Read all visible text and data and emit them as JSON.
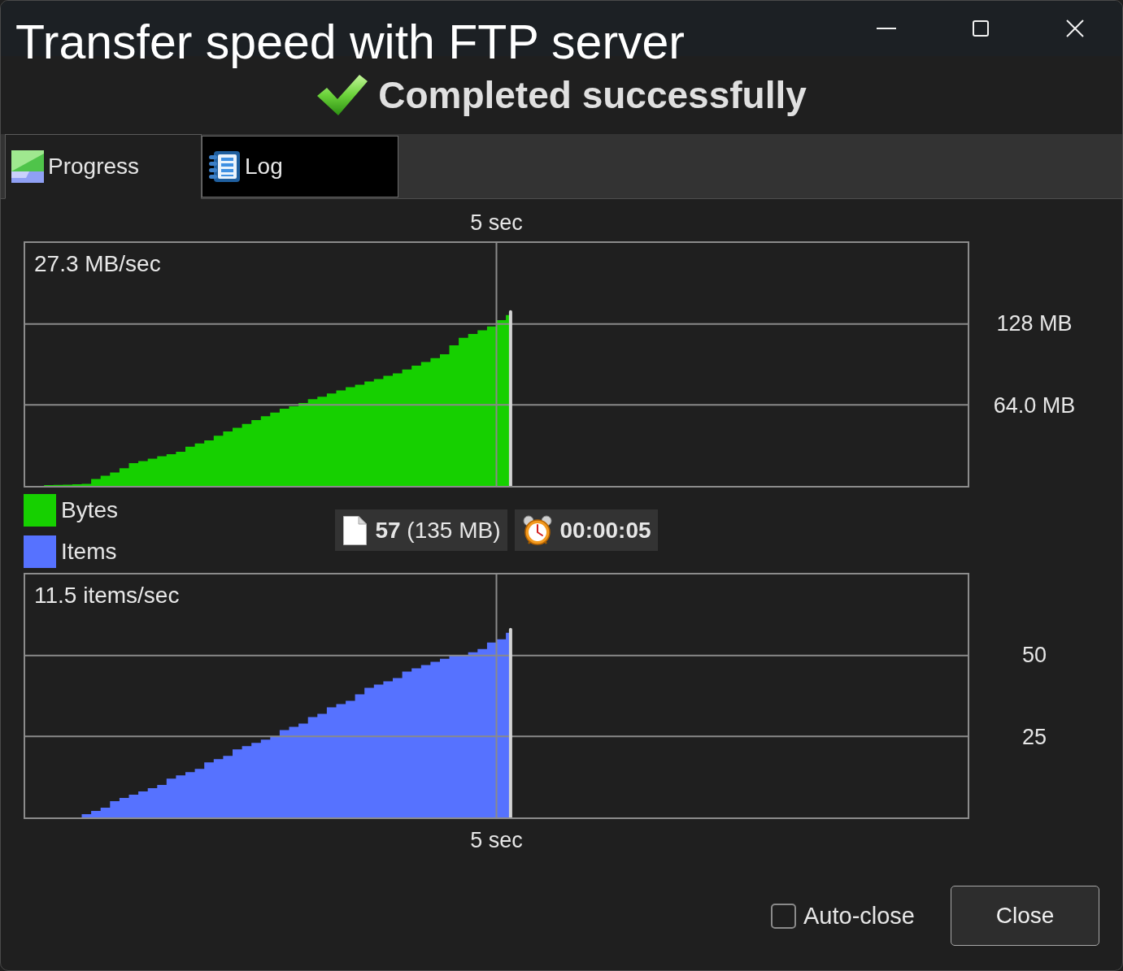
{
  "window": {
    "title": "Transfer speed with FTP server"
  },
  "status": {
    "message": "Completed successfully"
  },
  "tabs": [
    {
      "label": "Progress",
      "selected": true
    },
    {
      "label": "Log",
      "selected": false
    }
  ],
  "progress": {
    "bytes_chart": {
      "time_label": "5 sec",
      "speed": "27.3 MB/sec",
      "scale_labels": [
        "128 MB",
        "64.0 MB"
      ]
    },
    "legend": [
      {
        "label": "Bytes",
        "color": "#16d000"
      },
      {
        "label": "Items",
        "color": "#5672ff"
      }
    ],
    "stats": {
      "files": "**57** (135 MB)",
      "elapsed": "00:00:05"
    },
    "items_chart": {
      "speed": "11.5 items/sec",
      "scale_labels": [
        "50",
        "25"
      ],
      "time_label": "5 sec"
    }
  },
  "auto_close": {
    "label": "Auto-close",
    "checked": false
  },
  "buttons": [
    {
      "label": "Close"
    }
  ]
}
